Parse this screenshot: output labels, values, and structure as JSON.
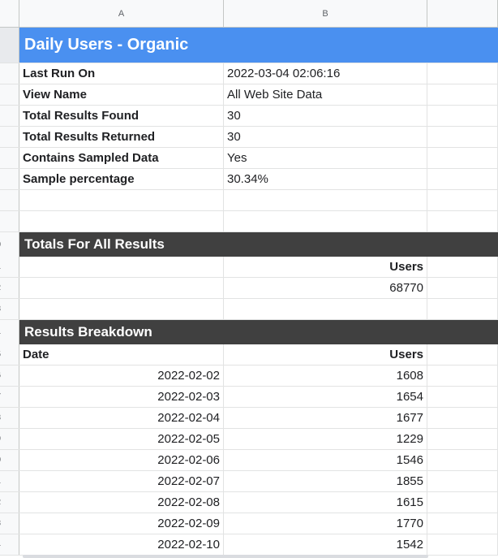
{
  "columns": {
    "a": "A",
    "b": "B"
  },
  "title": "Daily Users - Organic",
  "meta": [
    {
      "label": "Last Run On",
      "value": "2022-03-04 02:06:16"
    },
    {
      "label": "View Name",
      "value": "All Web Site Data"
    },
    {
      "label": "Total Results Found",
      "value": "30"
    },
    {
      "label": "Total Results Returned",
      "value": "30"
    },
    {
      "label": "Contains Sampled Data",
      "value": "Yes"
    },
    {
      "label": "Sample percentage",
      "value": "30.34%"
    }
  ],
  "row_numbers": [
    "0",
    "1",
    "2",
    "3",
    "4",
    "5",
    "6",
    "7",
    "8",
    "9",
    "0",
    "1",
    "2",
    "3",
    "4"
  ],
  "totals": {
    "title": "Totals For All Results",
    "header": "Users",
    "value": "68770"
  },
  "breakdown": {
    "title": "Results Breakdown",
    "headers": {
      "date": "Date",
      "users": "Users"
    },
    "rows": [
      {
        "date": "2022-02-02",
        "users": "1608"
      },
      {
        "date": "2022-02-03",
        "users": "1654"
      },
      {
        "date": "2022-02-04",
        "users": "1677"
      },
      {
        "date": "2022-02-05",
        "users": "1229"
      },
      {
        "date": "2022-02-06",
        "users": "1546"
      },
      {
        "date": "2022-02-07",
        "users": "1855"
      },
      {
        "date": "2022-02-08",
        "users": "1615"
      },
      {
        "date": "2022-02-09",
        "users": "1770"
      },
      {
        "date": "2022-02-10",
        "users": "1542"
      }
    ]
  }
}
